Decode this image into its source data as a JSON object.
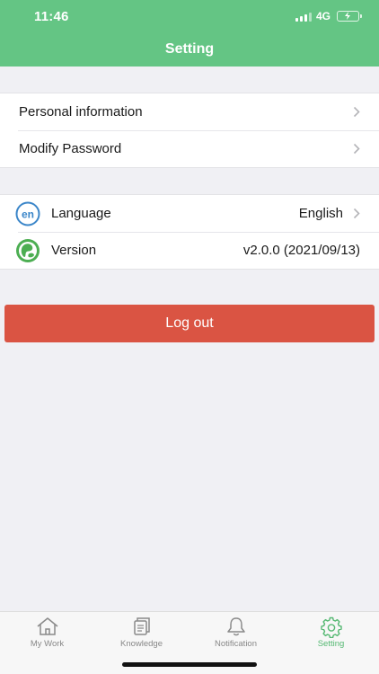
{
  "status_bar": {
    "time": "11:46",
    "network": "4G"
  },
  "header": {
    "title": "Setting"
  },
  "account_group": {
    "items": [
      {
        "label": "Personal information"
      },
      {
        "label": "Modify Password"
      }
    ]
  },
  "app_group": {
    "language": {
      "label": "Language",
      "value": "English",
      "icon": "language-en-icon"
    },
    "version": {
      "label": "Version",
      "value": "v2.0.0 (2021/09/13)",
      "icon": "app-logo-icon"
    }
  },
  "logout_label": "Log out",
  "tabbar": {
    "tabs": [
      {
        "label": "My Work",
        "icon": "home-icon"
      },
      {
        "label": "Knowledge",
        "icon": "document-icon"
      },
      {
        "label": "Notification",
        "icon": "bell-icon"
      },
      {
        "label": "Setting",
        "icon": "gear-icon",
        "active": true
      }
    ]
  },
  "colors": {
    "header": "#64c584",
    "logout": "#da5443",
    "active_tab": "#55b872"
  }
}
